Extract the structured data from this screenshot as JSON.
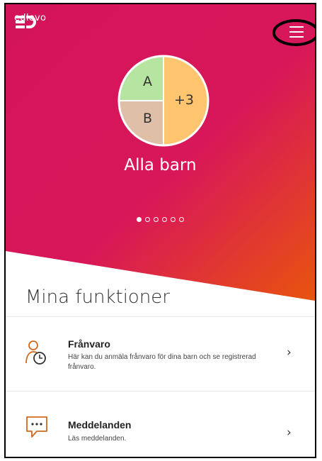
{
  "app": {
    "logo_text": "edlevo",
    "brand_gradient": [
      "#d4145a",
      "#e64a12"
    ]
  },
  "menu": {
    "icon": "hamburger-menu-icon",
    "highlight_color": "#000000"
  },
  "children_pie": {
    "segments": [
      {
        "label": "A",
        "color": "#b5e5a0",
        "share": 0.25
      },
      {
        "label": "B",
        "color": "#dfbfa7",
        "share": 0.25
      },
      {
        "label": "+3",
        "color": "#ffc56e",
        "share": 0.5
      }
    ]
  },
  "carousel": {
    "title": "Alla barn",
    "page_count": 6,
    "active_index": 0
  },
  "functions": {
    "heading": "Mina funktioner",
    "items": [
      {
        "title": "Frånvaro",
        "description": "Här kan du anmäla frånvaro för dina barn och se registrerad frånvaro.",
        "icon": "absence-person-clock-icon",
        "chevron": "›"
      },
      {
        "title": "Meddelanden",
        "description": "Läs meddelanden.",
        "icon": "message-bubble-icon",
        "chevron": "›"
      }
    ]
  }
}
